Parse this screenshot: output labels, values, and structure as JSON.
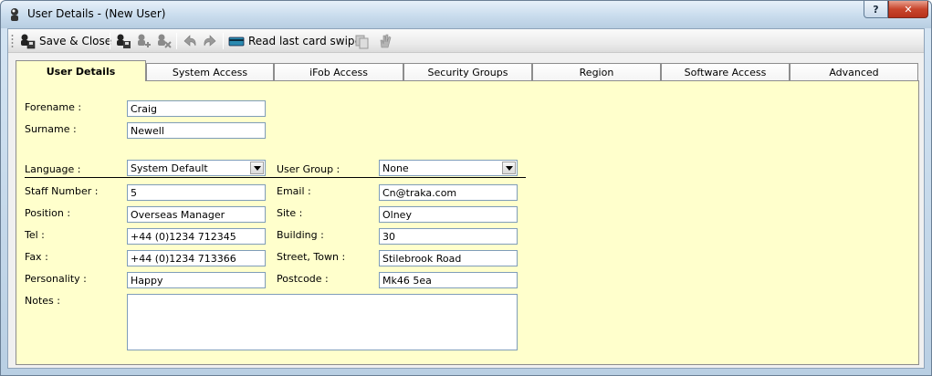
{
  "window": {
    "title": "User Details - (New User)",
    "help_label": "?",
    "close_label": "✕"
  },
  "toolbar": {
    "save_close_label": "Save & Close",
    "read_card_label": "Read last card swipe"
  },
  "tabs": [
    {
      "label": "User Details",
      "active": true
    },
    {
      "label": "System Access",
      "active": false
    },
    {
      "label": "iFob Access",
      "active": false
    },
    {
      "label": "Security Groups",
      "active": false
    },
    {
      "label": "Region",
      "active": false
    },
    {
      "label": "Software Access",
      "active": false
    },
    {
      "label": "Advanced",
      "active": false
    }
  ],
  "form": {
    "forename": {
      "label": "Forename :",
      "value": "Craig"
    },
    "surname": {
      "label": "Surname :",
      "value": "Newell"
    },
    "language": {
      "label": "Language :",
      "value": "System Default"
    },
    "staff_number": {
      "label": "Staff Number :",
      "value": "5"
    },
    "position": {
      "label": "Position :",
      "value": "Overseas Manager"
    },
    "tel": {
      "label": "Tel :",
      "value": "+44 (0)1234 712345"
    },
    "fax": {
      "label": "Fax :",
      "value": "+44 (0)1234 713366"
    },
    "personality": {
      "label": "Personality :",
      "value": "Happy"
    },
    "notes": {
      "label": "Notes :",
      "value": ""
    },
    "user_group": {
      "label": "User Group :",
      "value": "None"
    },
    "email": {
      "label": "Email :",
      "value": "Cn@traka.com"
    },
    "site": {
      "label": "Site :",
      "value": "Olney"
    },
    "building": {
      "label": "Building :",
      "value": "30"
    },
    "street_town": {
      "label": "Street, Town :",
      "value": "Stilebrook Road"
    },
    "postcode": {
      "label": "Postcode :",
      "value": "Mk46 5ea"
    }
  },
  "colors": {
    "panel_bg": "#ffffcc",
    "field_border": "#7f9db9",
    "close_button": "#c8452c"
  },
  "icons": [
    "app-icon",
    "save-close-icon",
    "save-add-icon",
    "add-user-icon",
    "remove-user-icon",
    "undo-icon",
    "redo-icon",
    "card-reader-icon",
    "copy-icon",
    "hand-icon"
  ]
}
